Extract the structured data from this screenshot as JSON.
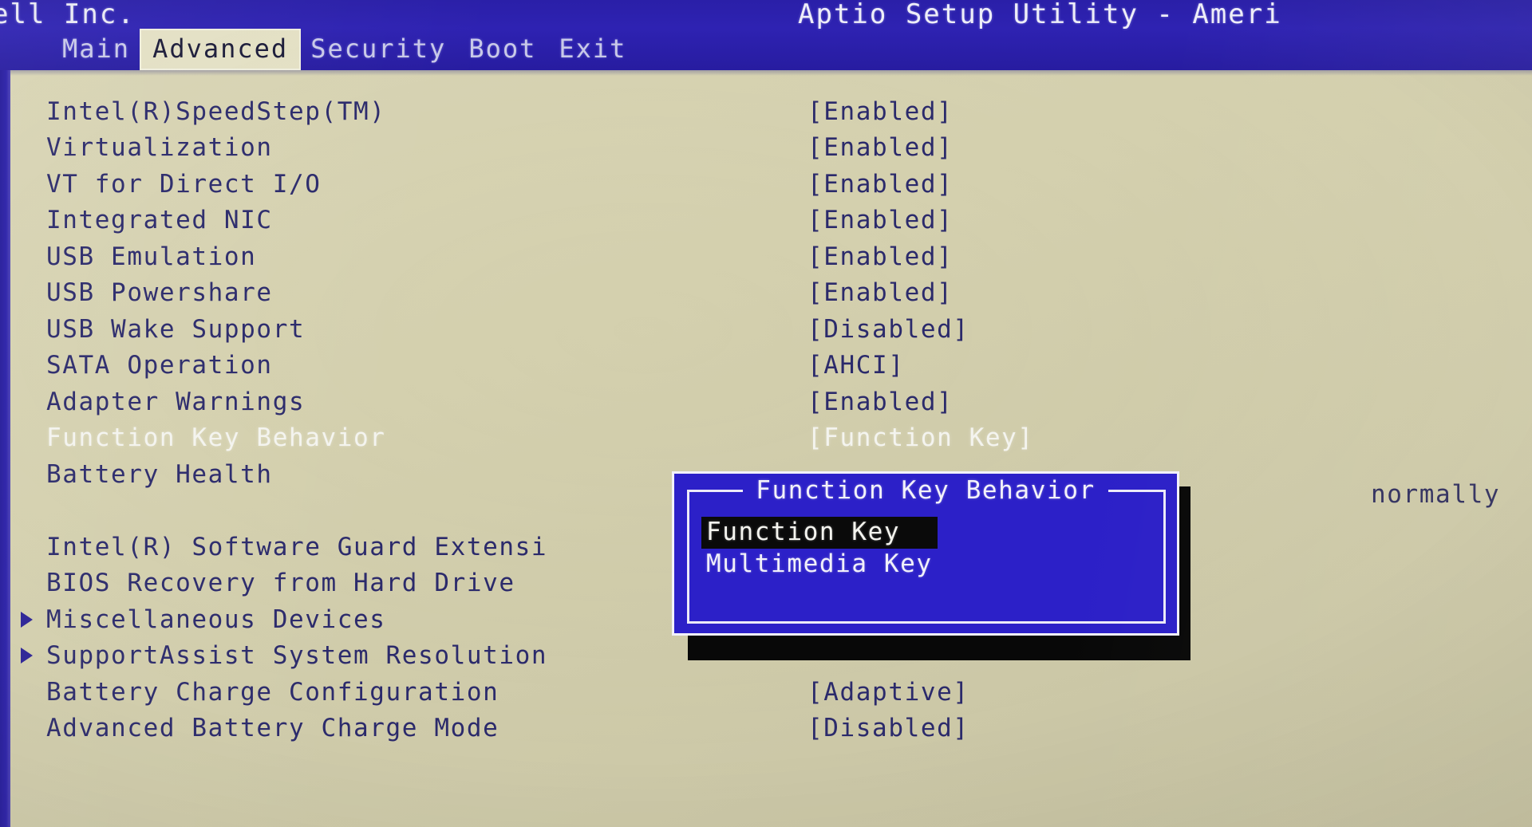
{
  "header": {
    "vendor": "ell Inc.",
    "app_title": "Aptio Setup Utility - Ameri",
    "background_color": "#2e22b2"
  },
  "tabs": [
    {
      "label": "Main",
      "active": false
    },
    {
      "label": "Advanced",
      "active": true
    },
    {
      "label": "Security",
      "active": false
    },
    {
      "label": "Boot",
      "active": false
    },
    {
      "label": "Exit",
      "active": false
    }
  ],
  "settings": [
    {
      "label": "Intel(R)SpeedStep(TM)",
      "value": "[Enabled]",
      "submenu": false,
      "selected": false
    },
    {
      "label": "Virtualization",
      "value": "[Enabled]",
      "submenu": false,
      "selected": false
    },
    {
      "label": "VT for Direct I/O",
      "value": "[Enabled]",
      "submenu": false,
      "selected": false
    },
    {
      "label": "Integrated NIC",
      "value": "[Enabled]",
      "submenu": false,
      "selected": false
    },
    {
      "label": "USB Emulation",
      "value": "[Enabled]",
      "submenu": false,
      "selected": false
    },
    {
      "label": "USB Powershare",
      "value": "[Enabled]",
      "submenu": false,
      "selected": false
    },
    {
      "label": "USB Wake Support",
      "value": "[Disabled]",
      "submenu": false,
      "selected": false
    },
    {
      "label": "SATA Operation",
      "value": "[AHCI]",
      "submenu": false,
      "selected": false
    },
    {
      "label": "Adapter Warnings",
      "value": "[Enabled]",
      "submenu": false,
      "selected": false
    },
    {
      "label": "Function Key Behavior",
      "value": "[Function Key]",
      "submenu": false,
      "selected": true
    },
    {
      "label": "Battery Health",
      "value": "",
      "submenu": false,
      "selected": false
    },
    {
      "label": "",
      "value": "",
      "submenu": false,
      "selected": false
    },
    {
      "label": "Intel(R) Software Guard Extensi",
      "value": "",
      "submenu": false,
      "selected": false
    },
    {
      "label": "BIOS Recovery from Hard Drive",
      "value": "",
      "submenu": false,
      "selected": false
    },
    {
      "label": "Miscellaneous Devices",
      "value": "",
      "submenu": true,
      "selected": false
    },
    {
      "label": "SupportAssist System Resolution",
      "value": "",
      "submenu": true,
      "selected": false
    },
    {
      "label": "Battery Charge Configuration",
      "value": "[Adaptive]",
      "submenu": false,
      "selected": false
    },
    {
      "label": "Advanced Battery Charge Mode",
      "value": "[Disabled]",
      "submenu": false,
      "selected": false
    }
  ],
  "help": {
    "text": "normally"
  },
  "popup": {
    "title": "Function Key Behavior",
    "options": [
      {
        "label": "Function Key",
        "highlighted": true
      },
      {
        "label": "Multimedia Key",
        "highlighted": false
      }
    ]
  }
}
